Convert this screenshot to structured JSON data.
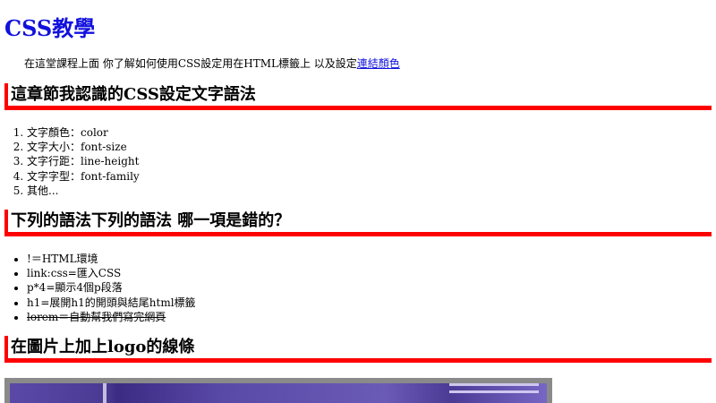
{
  "title": "CSS教學",
  "intro": {
    "text": "在這堂課程上面 你了解如何使用CSS設定用在HTML標籤上 以及設定",
    "link": "連結顏色"
  },
  "sections": [
    {
      "heading": "這章節我認識的CSS設定文字語法",
      "items": [
        "文字顏色：color",
        "文字大小：font-size",
        "文字行距：line-height",
        "文字字型：font-family",
        "其他..."
      ]
    },
    {
      "heading": "下列的語法下列的語法 哪一項是錯的？",
      "items": [
        "!＝HTML環境",
        "link:css=匯入CSS",
        "p*4=顯示4個p段落",
        "h1=展開h1的開頭與結尾html標籤",
        "lorem＝自動幫我們寫完網頁"
      ]
    },
    {
      "heading": "在圖片上加上logo的線條"
    }
  ],
  "colors": {
    "title": "#1111dd",
    "accent_border": "#ff0000",
    "link": "#1111dd"
  }
}
